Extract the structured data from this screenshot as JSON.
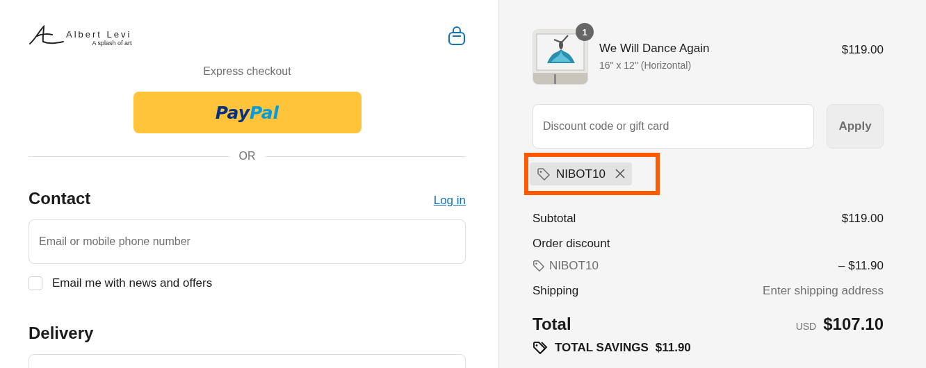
{
  "logo": {
    "name": "Albert Levi",
    "tagline": "A splash of art"
  },
  "express": {
    "title": "Express checkout",
    "paypal": [
      "Pay",
      "Pal"
    ],
    "divider": "OR"
  },
  "contact": {
    "title": "Contact",
    "login": "Log in",
    "email_placeholder": "Email or mobile phone number",
    "newsletter": {
      "label": "Email me with news and offers",
      "checked": false
    }
  },
  "delivery": {
    "title": "Delivery"
  },
  "cart": {
    "items": [
      {
        "kind": "picture",
        "quantity": "1",
        "name": "We Will Dance Again",
        "variant": "16\" x 12\" (Horizontal)",
        "price": "$119.00"
      }
    ]
  },
  "discount": {
    "placeholder": "Discount code or gift card",
    "apply": "Apply",
    "applied_code": "NIBOT10",
    "highlighted": true
  },
  "summary": {
    "subtotal_label": "Subtotal",
    "subtotal": "$119.00",
    "discount_label": "Order discount",
    "discount_code": "NIBOT10",
    "discount_amount": "– $11.90",
    "shipping_label": "Shipping",
    "shipping": "Enter shipping address",
    "total_label": "Total",
    "currency": "USD",
    "total": "$107.10",
    "savings_label": "TOTAL SAVINGS",
    "savings": "$11.90"
  }
}
